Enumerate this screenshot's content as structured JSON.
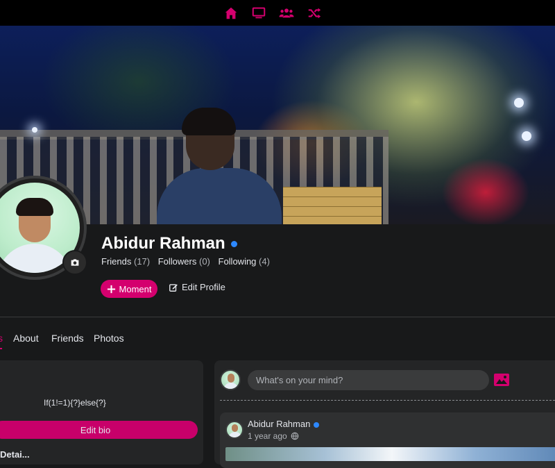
{
  "nav": {
    "icons": [
      "home-icon",
      "monitor-icon",
      "users-icon",
      "shuffle-icon"
    ],
    "accent": "#d4006e"
  },
  "profile": {
    "name": "Abidur Rahman",
    "stats": {
      "friends_label": "Friends",
      "friends_count": "(17)",
      "followers_label": "Followers",
      "followers_count": "(0)",
      "following_label": "Following",
      "following_count": "(4)"
    },
    "moment_label": "Moment",
    "edit_profile_label": "Edit Profile"
  },
  "tabs": {
    "active_fragment": "s",
    "items": [
      "About",
      "Friends",
      "Photos"
    ]
  },
  "intro": {
    "bio": "If(1!=1){?}else{?}",
    "edit_bio_label": "Edit bio",
    "next_section_fragment": "Detai..."
  },
  "composer": {
    "placeholder": "What's on your mind?"
  },
  "post": {
    "author": "Abidur Rahman",
    "time": "1 year ago"
  }
}
